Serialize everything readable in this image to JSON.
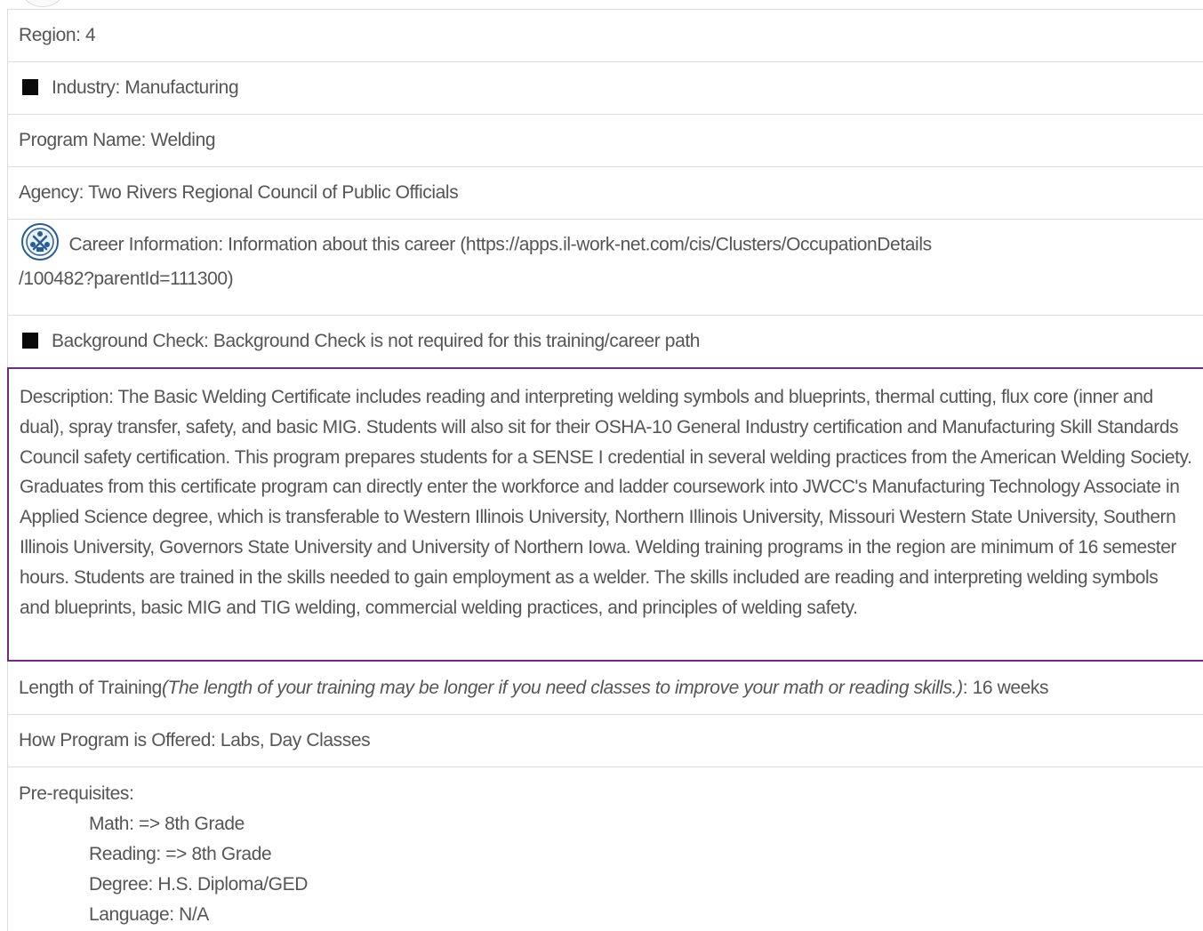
{
  "program": {
    "region": "Region: 4",
    "industry": "Industry: Manufacturing",
    "program_name": "Program Name: Welding",
    "agency": "Agency: Two Rivers Regional Council of Public Officials",
    "career_information_line1": "Career Information: Information about this career (https://apps.il-work-net.com/cis/Clusters/OccupationDetails",
    "career_information_line2": "/100482?parentId=111300)",
    "background_check": "Background Check: Background Check is not required for this training/career path",
    "description": "Description: The Basic Welding Certificate includes reading and interpreting welding symbols and blueprints, thermal cutting, flux core (inner and dual), spray transfer, safety, and basic MIG. Students will also sit for their OSHA-10 General Industry certification and Manufacturing Skill Standards Council safety certification. This program prepares students for a SENSE I credential in several welding practices from the American Welding Society. Graduates from this certificate program can directly enter the workforce and ladder coursework into JWCC's Manufacturing Technology Associate in Applied Science degree, which is transferable to Western Illinois University, Northern Illinois University, Missouri Western State University, Southern Illinois University, Governors State University and University of Northern Iowa. Welding training programs in the region are minimum of 16 semester hours. Students are trained in the skills needed to gain employment as a welder. The skills included are reading and interpreting welding symbols and blueprints, basic MIG and TIG welding, commercial welding practices, and principles of welding safety.",
    "length_label": "Length of Training ",
    "length_note": "(The length of your training may be longer if you need classes to improve your math or reading skills.)",
    "length_value": ": 16 weeks",
    "how_offered": "How Program is Offered: Labs, Day Classes",
    "prerequisites_title": "Pre-requisites:",
    "prerequisites": [
      "Math: => 8th Grade",
      "Reading: => 8th Grade",
      "Degree: H.S. Diploma/GED",
      "Language: N/A"
    ]
  },
  "icons": {
    "industry": "black-square-icon",
    "career": "career-cluster-icon",
    "background": "black-square-icon"
  },
  "colors": {
    "text": "#555555",
    "border": "#dcdcdc",
    "highlight_border": "#6e2c82",
    "icon_blue": "#2a5d8f"
  }
}
